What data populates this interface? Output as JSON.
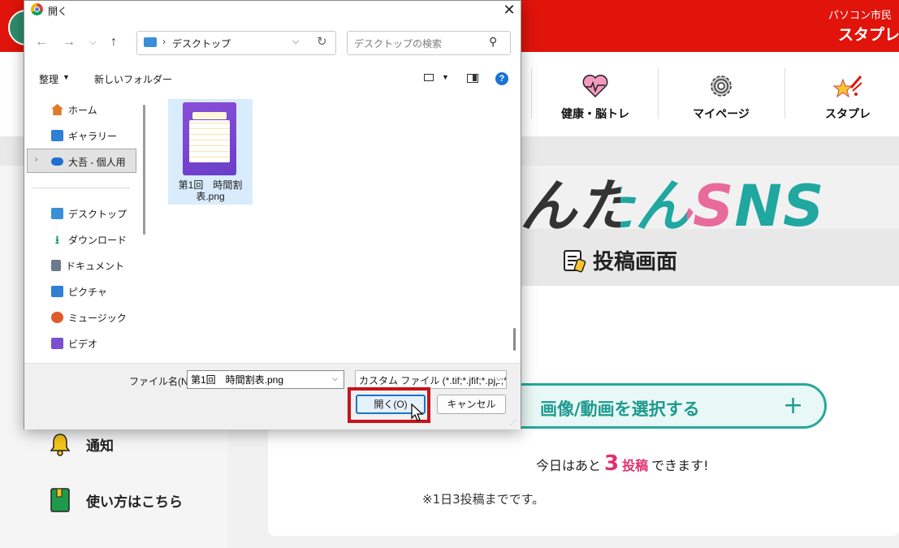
{
  "app": {
    "user_label": "パソコン市民",
    "app_name": "スタプレ",
    "nav": [
      {
        "label": "健康・脳トレ",
        "icon": "heart-pulse-icon"
      },
      {
        "label": "マイページ",
        "icon": "gear-icon"
      },
      {
        "label": "スタプレ",
        "icon": "stars-icon"
      }
    ],
    "sns_title": "んたんSNS",
    "post_title": "投稿画面",
    "select_button": "画像/動画を選択する",
    "select_plus": "+",
    "remaining": {
      "prefix": "今日はあと",
      "count": "3",
      "unit": "投稿",
      "suffix": "できます!"
    },
    "note": "※1日3投稿までです。",
    "sidebar": [
      {
        "label": "通知",
        "icon": "bell-icon"
      },
      {
        "label": "使い方はこちら",
        "icon": "book-icon"
      }
    ],
    "colors": {
      "brand_red": "#e0140b",
      "accent_teal": "#26a89c",
      "accent_pink": "#e0316a"
    }
  },
  "dialog": {
    "title": "開く",
    "close_glyph": "✕",
    "address": "デスクトップ",
    "search_placeholder": "デスクトップの検索",
    "commands": {
      "organize": "整理",
      "new_folder": "新しいフォルダー"
    },
    "nav_items": [
      {
        "label": "ホーム",
        "icon": "home-icon",
        "color": "#e07a2a",
        "pinned": false
      },
      {
        "label": "ギャラリー",
        "icon": "gallery-icon",
        "color": "#2f7fd6",
        "pinned": false
      },
      {
        "label": "大吾 - 個人用",
        "icon": "onedrive-icon",
        "color": "#1f6fd1",
        "pinned": false
      },
      {
        "label": "デスクトップ",
        "icon": "desktop-icon",
        "color": "#3a8fd8",
        "pinned": true
      },
      {
        "label": "ダウンロード",
        "icon": "download-icon",
        "color": "#1e9e61",
        "pinned": true
      },
      {
        "label": "ドキュメント",
        "icon": "document-icon",
        "color": "#6b7b8c",
        "pinned": true
      },
      {
        "label": "ピクチャ",
        "icon": "picture-icon",
        "color": "#2f7fd6",
        "pinned": true
      },
      {
        "label": "ミュージック",
        "icon": "music-icon",
        "color": "#e05a2a",
        "pinned": true
      },
      {
        "label": "ビデオ",
        "icon": "video-icon",
        "color": "#7b4fd0",
        "pinned": true
      }
    ],
    "pin_glyph": "📌",
    "file": {
      "name_line1": "第1回　時間割",
      "name_line2": "表.png"
    },
    "filename_label": "ファイル名(N):",
    "filename_value": "第1回　時間割表.png",
    "filetype_value": "カスタム ファイル (*.tif;*.jfif;*.pjp;*.x",
    "open_label": "開く(O)",
    "cancel_label": "キャンセル"
  }
}
